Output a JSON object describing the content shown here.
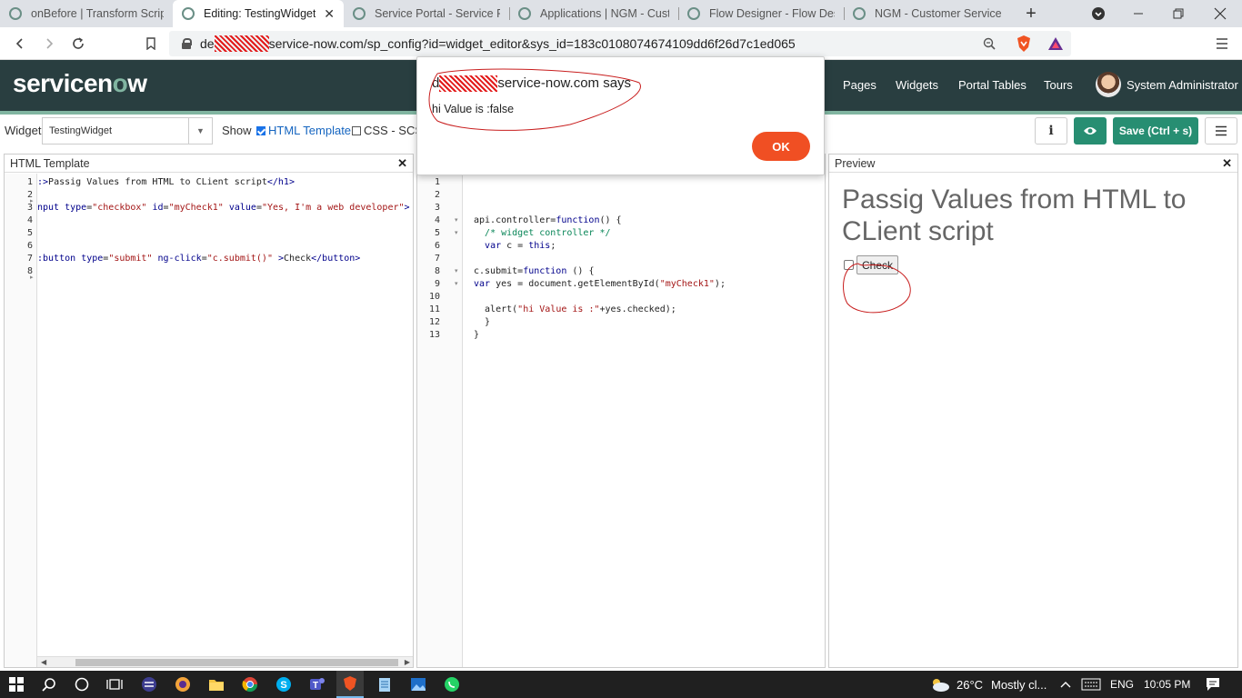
{
  "browser": {
    "tabs": [
      {
        "label": "onBefore | Transform Script",
        "active": false
      },
      {
        "label": "Editing: TestingWidget",
        "active": true
      },
      {
        "label": "Service Portal - Service Portal",
        "active": false
      },
      {
        "label": "Applications | NGM - Customer",
        "active": false
      },
      {
        "label": "Flow Designer - Flow Designer",
        "active": false
      },
      {
        "label": "NGM - Customer Service and",
        "active": false
      }
    ],
    "new_tab": "+",
    "url_prefix": "de",
    "url_rest": "service-now.com/sp_config?id=widget_editor&sys_id=183c0108074674109dd6f26d7c1ed065"
  },
  "header": {
    "logo_pre": "servicen",
    "logo_o": "o",
    "logo_post": "w",
    "nav": [
      "Pages",
      "Widgets",
      "Portal Tables",
      "Tours"
    ],
    "user": "System Administrator"
  },
  "toolbar": {
    "widget_label": "Widget",
    "widget_value": "TestingWidget",
    "show_label": "Show",
    "html_template": "HTML Template",
    "css_scss": "CSS - SCSS",
    "info": "i",
    "save": "Save (Ctrl + s)"
  },
  "html_pane": {
    "title": "HTML Template",
    "lines": [
      "1",
      "2",
      "3",
      "4",
      "5",
      "6",
      "7",
      "8"
    ]
  },
  "client_pane": {
    "lines": [
      "1",
      "2",
      "3",
      "4",
      "5",
      "6",
      "7",
      "8",
      "9",
      "10",
      "11",
      "12",
      "13"
    ]
  },
  "preview": {
    "title": "Preview",
    "heading": "Passig Values from HTML to CLient script",
    "button": "Check"
  },
  "dialog": {
    "title_prefix": "d",
    "title_rest": "service-now.com says",
    "message": "hi Value is :false",
    "ok": "OK"
  },
  "taskbar": {
    "temp": "26°C",
    "weather": "Mostly cl...",
    "lang": "ENG",
    "time": "10:05 PM"
  },
  "colors": {
    "header_bg": "#293e40",
    "accent_green": "#81b5a1",
    "save_green": "#278e72",
    "ok_orange": "#f04f23"
  }
}
